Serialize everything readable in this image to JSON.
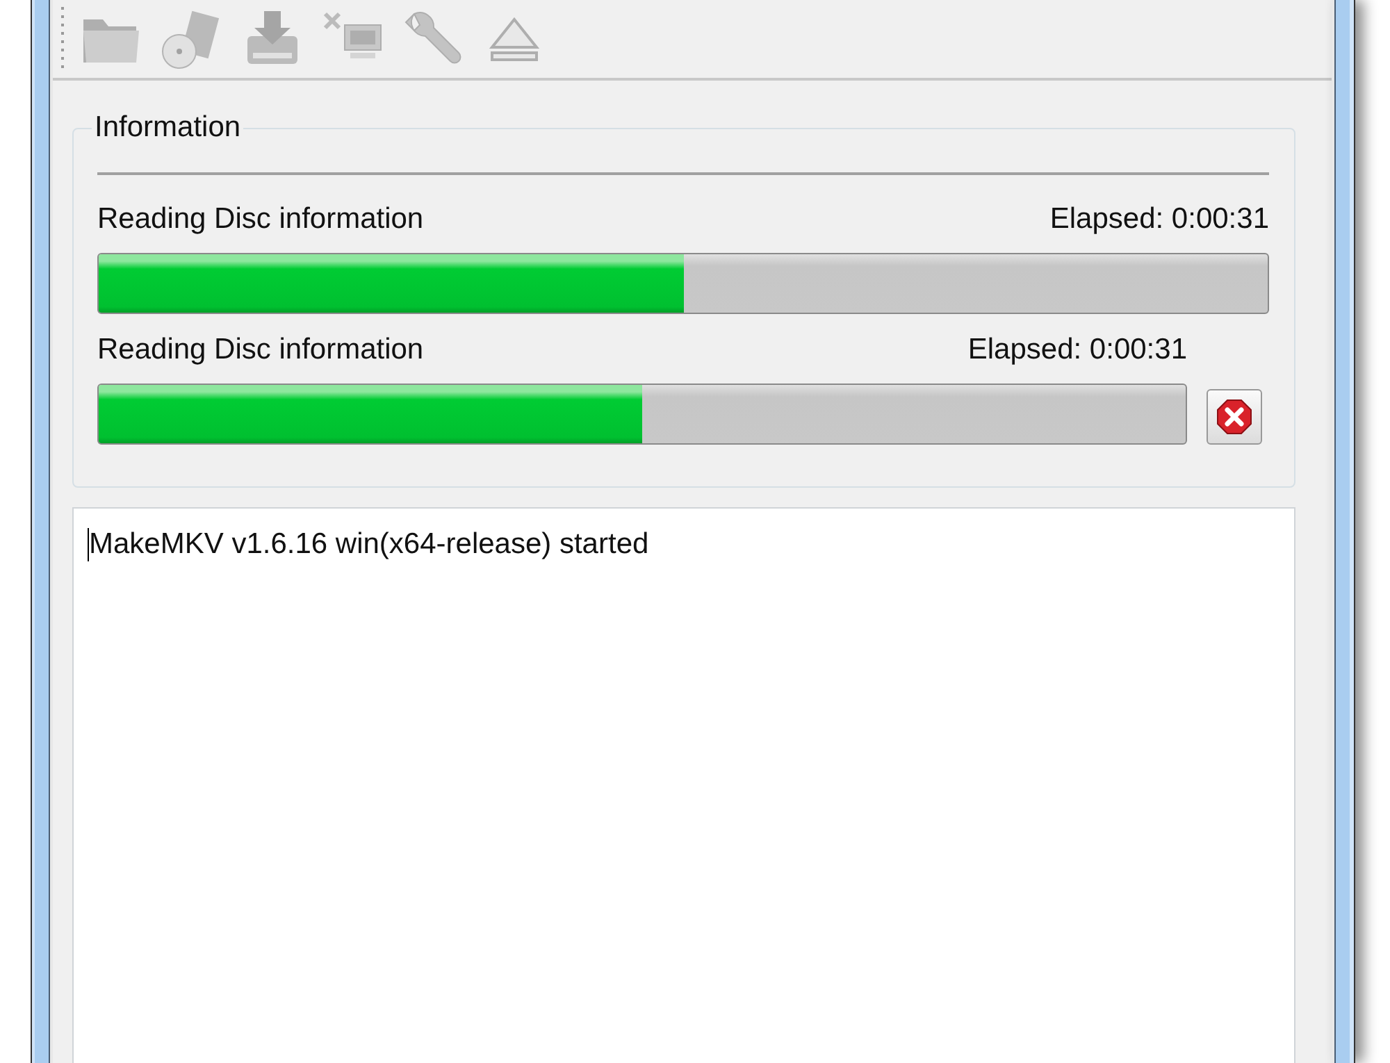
{
  "toolbar": [
    {
      "kind": "folder",
      "disabled": true
    },
    {
      "kind": "disc-box",
      "disabled": true
    },
    {
      "kind": "drive",
      "disabled": true
    },
    {
      "kind": "network",
      "disabled": true
    },
    {
      "kind": "wrench",
      "disabled": true
    },
    {
      "kind": "eject",
      "disabled": true
    }
  ],
  "information": {
    "title": "Information",
    "tasks": [
      {
        "label": "Reading Disc information",
        "elapsed": "Elapsed: 0:00:31",
        "level": 0.5,
        "cancel": false
      },
      {
        "label": "Reading Disc information",
        "elapsed": "Elapsed: 0:00:31",
        "level": 0.5,
        "cancel": true
      }
    ]
  },
  "log": {
    "lines": [
      "MakeMKV v1.6.16 win(x64-release) started"
    ]
  }
}
